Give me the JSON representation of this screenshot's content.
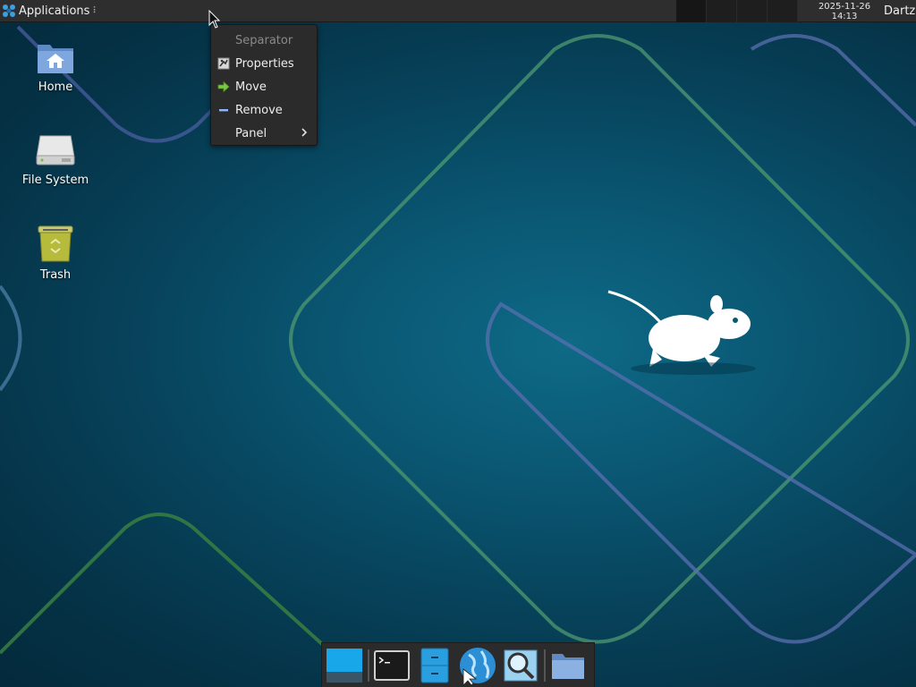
{
  "top_panel": {
    "applications_label": "Applications",
    "grip_glyph": "⠇",
    "clock_date": "2025-11-26",
    "clock_time": "14:13",
    "user": "Dartz",
    "logo_icon": "xfce-logo-icon"
  },
  "context_menu": {
    "items": [
      {
        "label": "Separator",
        "enabled": false,
        "icon": ""
      },
      {
        "label": "Properties",
        "enabled": true,
        "icon": "properties-icon"
      },
      {
        "label": "Move",
        "enabled": true,
        "icon": "move-arrow-icon"
      },
      {
        "label": "Remove",
        "enabled": true,
        "icon": "remove-icon"
      },
      {
        "label": "Panel",
        "enabled": true,
        "icon": "",
        "submenu": true
      }
    ]
  },
  "desktop_icons": [
    {
      "label": "Home",
      "icon": "home-folder-icon"
    },
    {
      "label": "File System",
      "icon": "drive-icon"
    },
    {
      "label": "Trash",
      "icon": "trash-icon"
    }
  ],
  "dock": {
    "items": [
      {
        "name": "show-desktop",
        "icon": "show-desktop-icon"
      },
      {
        "name": "terminal",
        "icon": "terminal-icon"
      },
      {
        "name": "file-manager",
        "icon": "file-cabinet-icon"
      },
      {
        "name": "web-browser",
        "icon": "globe-icon"
      },
      {
        "name": "app-finder",
        "icon": "magnifier-icon"
      },
      {
        "name": "folder",
        "icon": "folder-icon"
      }
    ]
  },
  "colors": {
    "panel_bg": "#2e2e2e",
    "menu_bg": "#2b2b2b",
    "desktop_center": "#0e6a86",
    "desktop_edge": "#042a3c",
    "line_green": "#4f9a72",
    "line_blue": "#5a6fb0"
  }
}
